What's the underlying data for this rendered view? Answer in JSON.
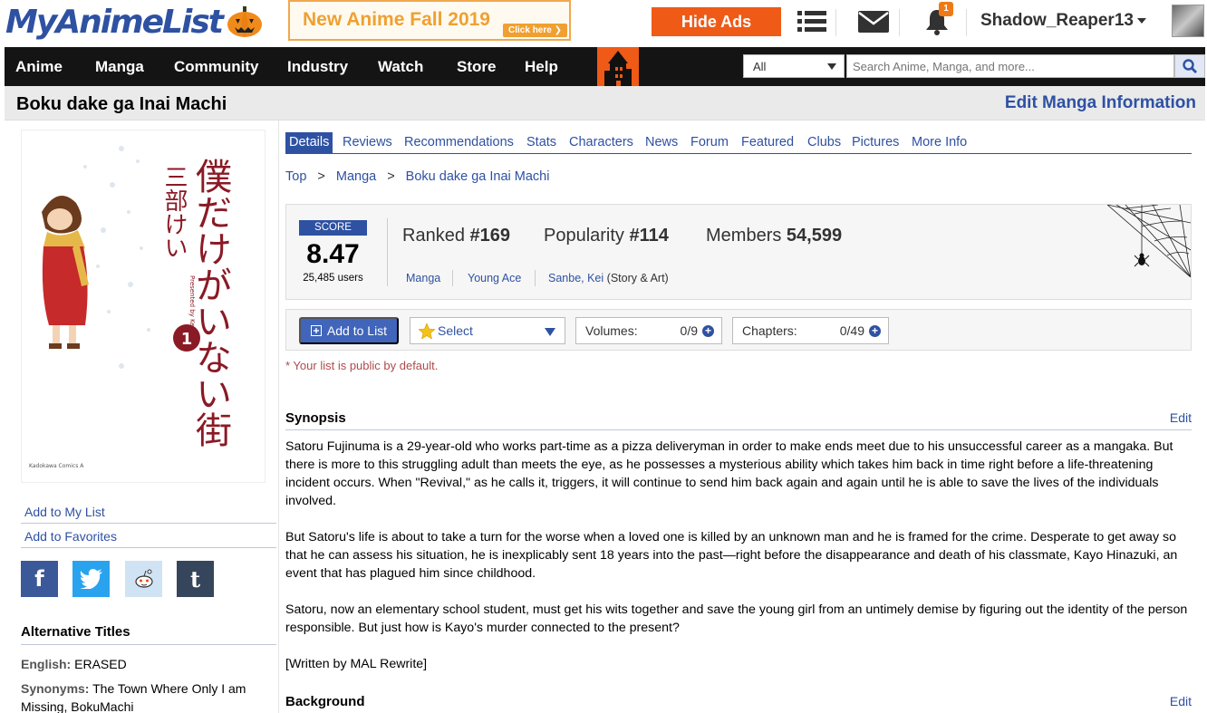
{
  "header": {
    "logo_text": "MyAnimeList",
    "banner_text": "New Anime Fall 2019",
    "banner_click": "Click here",
    "hide_ads": "Hide Ads",
    "notification_count": "1",
    "username": "Shadow_Reaper13"
  },
  "nav": {
    "items": [
      "Anime",
      "Manga",
      "Community",
      "Industry",
      "Watch",
      "Store",
      "Help"
    ],
    "search_filter": "All",
    "search_placeholder": "Search Anime, Manga, and more..."
  },
  "title_bar": {
    "title": "Boku dake ga Inai Machi",
    "edit_link": "Edit Manga Information"
  },
  "cover": {
    "title_jp": "僕だけがいない街",
    "author_jp": "三部けい",
    "volume": "1",
    "imprint": "Kadokawa Comics A"
  },
  "left": {
    "add_to_list": "Add to My List",
    "add_to_favorites": "Add to Favorites",
    "social": [
      "f",
      "t",
      "r",
      "t"
    ],
    "alt_titles_heading": "Alternative Titles",
    "english_label": "English:",
    "english_value": "ERASED",
    "synonyms_label": "Synonyms:",
    "synonyms_value": "The Town Where Only I am Missing, BokuMachi"
  },
  "tabs": [
    "Details",
    "Reviews",
    "Recommendations",
    "Stats",
    "Characters",
    "News",
    "Forum",
    "Featured",
    "Clubs",
    "Pictures",
    "More Info"
  ],
  "breadcrumbs": [
    "Top",
    "Manga",
    "Boku dake ga Inai Machi"
  ],
  "score": {
    "label": "SCORE",
    "value": "8.47",
    "users": "25,485 users",
    "ranked_label": "Ranked",
    "ranked_value": "#169",
    "popularity_label": "Popularity",
    "popularity_value": "#114",
    "members_label": "Members",
    "members_value": "54,599",
    "type": "Manga",
    "magazine": "Young Ace",
    "author": "Sanbe, Kei",
    "author_role": "(Story & Art)"
  },
  "list_controls": {
    "add_button": "Add to List",
    "select_label": "Select",
    "volumes_label": "Volumes:",
    "volumes_value": "0/9",
    "chapters_label": "Chapters:",
    "chapters_value": "0/49",
    "public_note": "* Your list is public by default."
  },
  "synopsis": {
    "heading": "Synopsis",
    "edit": "Edit",
    "paragraphs": [
      "Satoru Fujinuma is a 29-year-old who works part-time as a pizza deliveryman in order to make ends meet due to his unsuccessful career as a mangaka. But there is more to this struggling adult than meets the eye, as he possesses a mysterious ability which takes him back in time right before a life-threatening incident occurs. When \"Revival,\" as he calls it, triggers, it will continue to send him back again and again until he is able to save the lives of the individuals involved.",
      "But Satoru's life is about to take a turn for the worse when a loved one is killed by an unknown man and he is framed for the crime. Desperate to get away so that he can assess his situation, he is inexplicably sent 18 years into the past—right before the disappearance and death of his classmate, Kayo Hinazuki, an event that has plagued him since childhood.",
      "Satoru, now an elementary school student, must get his wits together and save the young girl from an untimely demise by figuring out the identity of the person responsible. But just how is Kayo's murder connected to the present?",
      "[Written by MAL Rewrite]"
    ]
  },
  "background": {
    "heading": "Background",
    "edit": "Edit"
  },
  "colors": {
    "brand_blue": "#2e51a2",
    "orange": "#ef5a17",
    "nav_bg": "#141414"
  }
}
